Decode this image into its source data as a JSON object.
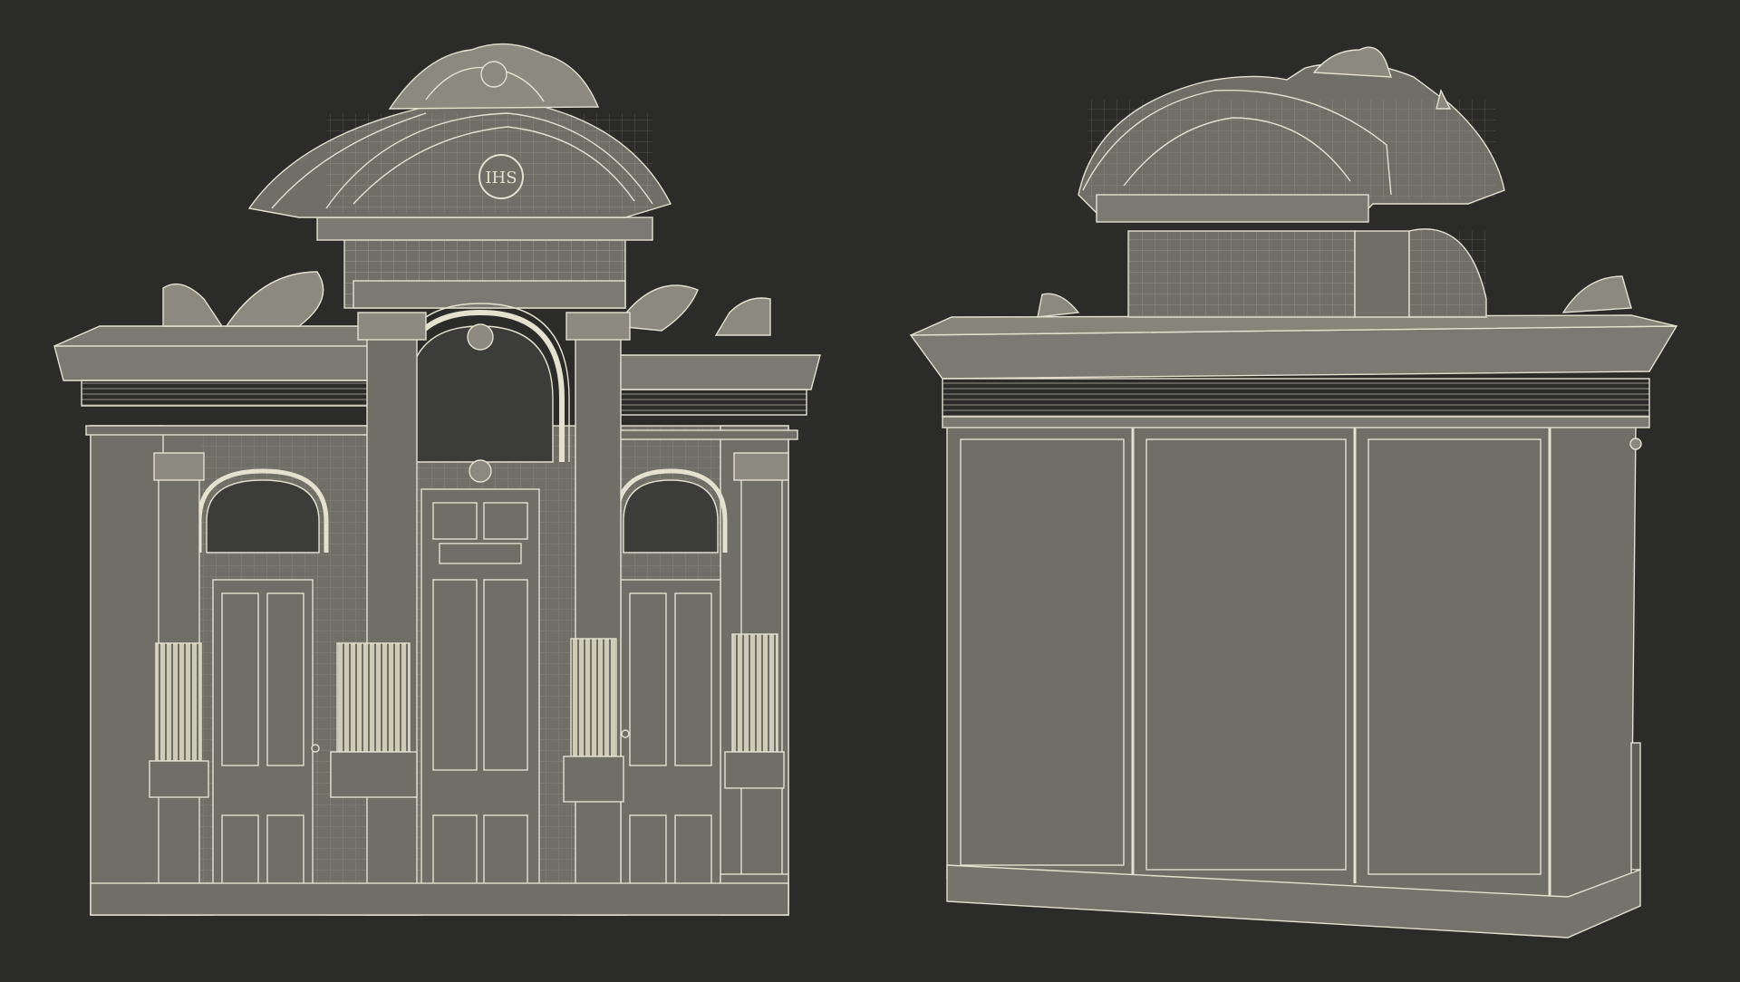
{
  "scene": {
    "background_color": "#2b2b2a",
    "body_color": "#6f6f68",
    "wire_color": "#e4e1d0",
    "edge_dark": "#4a4a45"
  },
  "front_view": {
    "monogram": "IHS"
  }
}
